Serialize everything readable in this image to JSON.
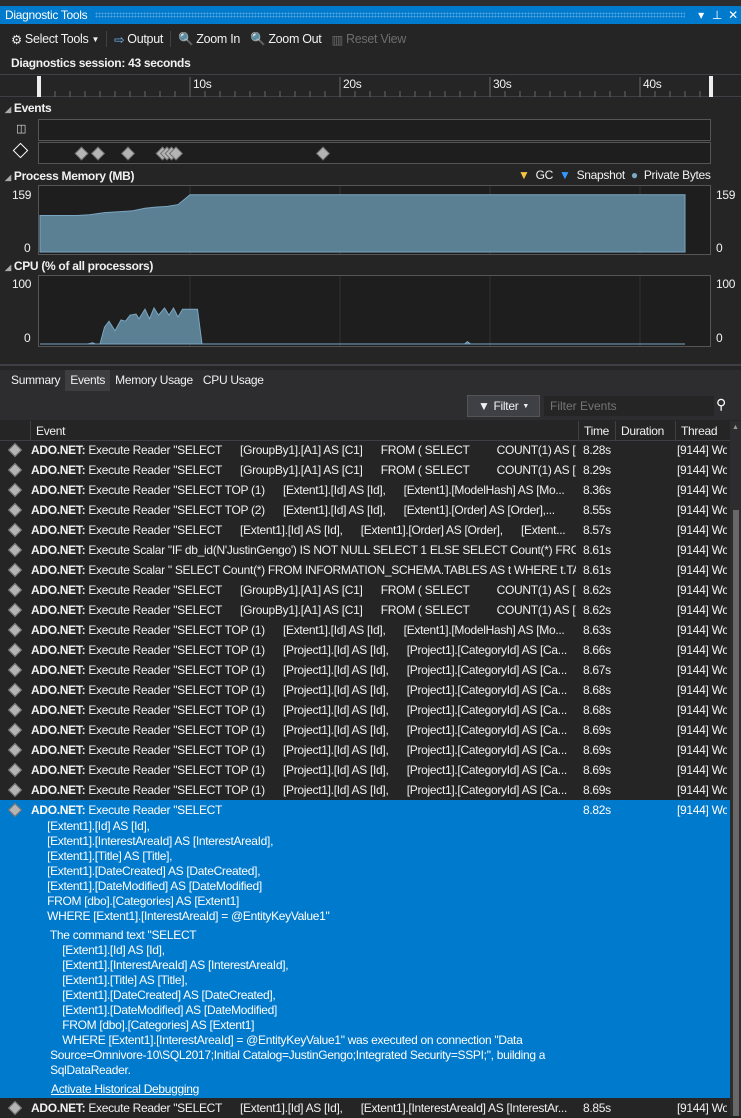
{
  "window": {
    "title": "Diagnostic Tools",
    "dropdown_icon": "▾",
    "pin_icon": "⊥",
    "close_icon": "✕"
  },
  "toolbar": {
    "select_tools": "Select Tools",
    "output": "Output",
    "zoom_in": "Zoom In",
    "zoom_out": "Zoom Out",
    "reset_view": "Reset View"
  },
  "session": "Diagnostics session: 43 seconds",
  "ruler": {
    "ticks": [
      "10s",
      "20s",
      "30s",
      "40s"
    ],
    "duration_s": 43
  },
  "events_lane": {
    "title": "Events",
    "marker_times_s": [
      2.7,
      3.8,
      5.8,
      8.1,
      8.4,
      8.7,
      9.0,
      18.8
    ]
  },
  "memory": {
    "title": "Process Memory (MB)",
    "legend": [
      "GC",
      "Snapshot",
      "Private Bytes"
    ],
    "colors": {
      "gc": "#f5c542",
      "snapshot": "#3399ff",
      "private_bytes": "#7aa7c2"
    },
    "max_label": "159",
    "min_label": "0",
    "series": [
      [
        0,
        100
      ],
      [
        2.5,
        100
      ],
      [
        3.3,
        102
      ],
      [
        4.3,
        108
      ],
      [
        5.5,
        111
      ],
      [
        6.2,
        113
      ],
      [
        7,
        120
      ],
      [
        7.7,
        123
      ],
      [
        8.5,
        125
      ],
      [
        9.2,
        130
      ],
      [
        10,
        157
      ],
      [
        43,
        157
      ]
    ]
  },
  "cpu": {
    "title": "CPU (% of all processors)",
    "max_label": "100",
    "min_label": "0",
    "series": [
      [
        0,
        0
      ],
      [
        3.2,
        0
      ],
      [
        3.5,
        2
      ],
      [
        3.7,
        0
      ],
      [
        4.0,
        0
      ],
      [
        4.3,
        28
      ],
      [
        4.6,
        38
      ],
      [
        5.0,
        22
      ],
      [
        5.4,
        40
      ],
      [
        5.7,
        38
      ],
      [
        6.0,
        48
      ],
      [
        6.4,
        50
      ],
      [
        6.6,
        42
      ],
      [
        7.0,
        58
      ],
      [
        7.3,
        42
      ],
      [
        7.6,
        60
      ],
      [
        7.9,
        48
      ],
      [
        8.3,
        60
      ],
      [
        8.6,
        48
      ],
      [
        8.9,
        60
      ],
      [
        9.2,
        45
      ],
      [
        9.5,
        58
      ],
      [
        10.5,
        58
      ],
      [
        10.8,
        0
      ],
      [
        28.3,
        0
      ],
      [
        28.5,
        4
      ],
      [
        28.7,
        0
      ],
      [
        43,
        0
      ]
    ]
  },
  "tabs": [
    {
      "label": "Summary"
    },
    {
      "label": "Events"
    },
    {
      "label": "Memory Usage"
    },
    {
      "label": "CPU Usage"
    }
  ],
  "active_tab": "Events",
  "filter": {
    "label": "Filter",
    "placeholder": "Filter Events"
  },
  "columns": {
    "event": "Event",
    "time": "Time",
    "duration": "Duration",
    "thread": "Thread"
  },
  "rows": [
    {
      "src": "ADO.NET:",
      "text": " Execute Reader \"SELECT      [GroupBy1].[A1] AS [C1]      FROM ( SELECT         COUNT(1) AS [...",
      "time": "8.28s",
      "thread": "[9144] Wo"
    },
    {
      "src": "ADO.NET:",
      "text": " Execute Reader \"SELECT      [GroupBy1].[A1] AS [C1]      FROM ( SELECT         COUNT(1) AS [...",
      "time": "8.29s",
      "thread": "[9144] Wo"
    },
    {
      "src": "ADO.NET:",
      "text": " Execute Reader \"SELECT TOP (1)      [Extent1].[Id] AS [Id],      [Extent1].[ModelHash] AS [Mo...",
      "time": "8.36s",
      "thread": "[9144] Wo"
    },
    {
      "src": "ADO.NET:",
      "text": " Execute Reader \"SELECT TOP (2)      [Extent1].[Id] AS [Id],      [Extent1].[Order] AS [Order],...",
      "time": "8.55s",
      "thread": "[9144] Wo"
    },
    {
      "src": "ADO.NET:",
      "text": " Execute Reader \"SELECT      [Extent1].[Id] AS [Id],      [Extent1].[Order] AS [Order],      [Extent...",
      "time": "8.57s",
      "thread": "[9144] Wo"
    },
    {
      "src": "ADO.NET:",
      "text": " Execute Scalar \"IF db_id(N'JustinGengo') IS NOT NULL SELECT 1 ELSE SELECT Count(*) FRO...",
      "time": "8.61s",
      "thread": "[9144] Wo"
    },
    {
      "src": "ADO.NET:",
      "text": " Execute Scalar \" SELECT Count(*) FROM INFORMATION_SCHEMA.TABLES AS t WHERE t.TA...",
      "time": "8.61s",
      "thread": "[9144] Wo"
    },
    {
      "src": "ADO.NET:",
      "text": " Execute Reader \"SELECT      [GroupBy1].[A1] AS [C1]      FROM ( SELECT         COUNT(1) AS [...",
      "time": "8.62s",
      "thread": "[9144] Wo"
    },
    {
      "src": "ADO.NET:",
      "text": " Execute Reader \"SELECT      [GroupBy1].[A1] AS [C1]      FROM ( SELECT         COUNT(1) AS [...",
      "time": "8.62s",
      "thread": "[9144] Wo"
    },
    {
      "src": "ADO.NET:",
      "text": " Execute Reader \"SELECT TOP (1)      [Extent1].[Id] AS [Id],      [Extent1].[ModelHash] AS [Mo...",
      "time": "8.63s",
      "thread": "[9144] Wo"
    },
    {
      "src": "ADO.NET:",
      "text": " Execute Reader \"SELECT TOP (1)      [Project1].[Id] AS [Id],      [Project1].[CategoryId] AS [Ca...",
      "time": "8.66s",
      "thread": "[9144] Wo"
    },
    {
      "src": "ADO.NET:",
      "text": " Execute Reader \"SELECT TOP (1)      [Project1].[Id] AS [Id],      [Project1].[CategoryId] AS [Ca...",
      "time": "8.67s",
      "thread": "[9144] Wo"
    },
    {
      "src": "ADO.NET:",
      "text": " Execute Reader \"SELECT TOP (1)      [Project1].[Id] AS [Id],      [Project1].[CategoryId] AS [Ca...",
      "time": "8.68s",
      "thread": "[9144] Wo"
    },
    {
      "src": "ADO.NET:",
      "text": " Execute Reader \"SELECT TOP (1)      [Project1].[Id] AS [Id],      [Project1].[CategoryId] AS [Ca...",
      "time": "8.68s",
      "thread": "[9144] Wo"
    },
    {
      "src": "ADO.NET:",
      "text": " Execute Reader \"SELECT TOP (1)      [Project1].[Id] AS [Id],      [Project1].[CategoryId] AS [Ca...",
      "time": "8.69s",
      "thread": "[9144] Wo"
    },
    {
      "src": "ADO.NET:",
      "text": " Execute Reader \"SELECT TOP (1)      [Project1].[Id] AS [Id],      [Project1].[CategoryId] AS [Ca...",
      "time": "8.69s",
      "thread": "[9144] Wo"
    },
    {
      "src": "ADO.NET:",
      "text": " Execute Reader \"SELECT TOP (1)      [Project1].[Id] AS [Id],      [Project1].[CategoryId] AS [Ca...",
      "time": "8.69s",
      "thread": "[9144] Wo"
    },
    {
      "src": "ADO.NET:",
      "text": " Execute Reader \"SELECT TOP (1)      [Project1].[Id] AS [Id],      [Project1].[CategoryId] AS [Ca...",
      "time": "8.69s",
      "thread": "[9144] Wo"
    }
  ],
  "selected": {
    "src": "ADO.NET:",
    "text": " Execute Reader \"SELECT",
    "time": "8.82s",
    "thread": "[9144] Wo",
    "query": "  [Extent1].[Id] AS [Id],\n  [Extent1].[InterestAreaId] AS [InterestAreaId],\n  [Extent1].[Title] AS [Title],\n  [Extent1].[DateCreated] AS [DateCreated],\n  [Extent1].[DateModified] AS [DateModified]\n  FROM [dbo].[Categories] AS [Extent1]\n  WHERE [Extent1].[InterestAreaId] = @EntityKeyValue1\"",
    "description": "   The command text \"SELECT\n       [Extent1].[Id] AS [Id],\n       [Extent1].[InterestAreaId] AS [InterestAreaId],\n       [Extent1].[Title] AS [Title],\n       [Extent1].[DateCreated] AS [DateCreated],\n       [Extent1].[DateModified] AS [DateModified]\n       FROM [dbo].[Categories] AS [Extent1]\n       WHERE [Extent1].[InterestAreaId] = @EntityKeyValue1\" was executed on connection \"Data\n   Source=Omnivore-10\\SQL2017;Initial Catalog=JustinGengo;Integrated Security=SSPI;\", building a\n   SqlDataReader.",
    "link": "Activate Historical Debugging"
  },
  "last_row": {
    "src": "ADO.NET:",
    "text": " Execute Reader \"SELECT      [Extent1].[Id] AS [Id],      [Extent1].[InterestAreaId] AS [InterestAr...",
    "time": "8.85s",
    "thread": "[9144] Wo"
  }
}
